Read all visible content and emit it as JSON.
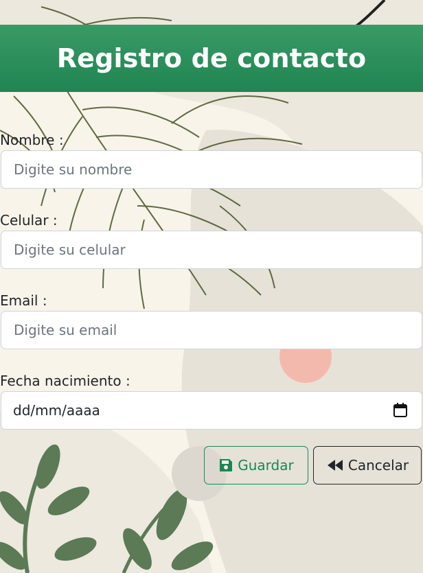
{
  "header": {
    "title": "Registro de contacto"
  },
  "form": {
    "fields": [
      {
        "label": "Nombre :",
        "placeholder": "Digite su nombre"
      },
      {
        "label": "Celular :",
        "placeholder": "Digite su celular"
      },
      {
        "label": "Email :",
        "placeholder": "Digite su email"
      },
      {
        "label": "Fecha nacimiento :",
        "placeholder": "dd/mm/aaaa"
      }
    ]
  },
  "actions": {
    "save_label": "Guardar",
    "cancel_label": "Cancelar"
  },
  "colors": {
    "header": "#1f8552",
    "save": "#198754",
    "cancel": "#212529"
  },
  "icons": {
    "save": "floppy-disk-icon",
    "cancel": "backward-icon",
    "date": "calendar-icon"
  }
}
